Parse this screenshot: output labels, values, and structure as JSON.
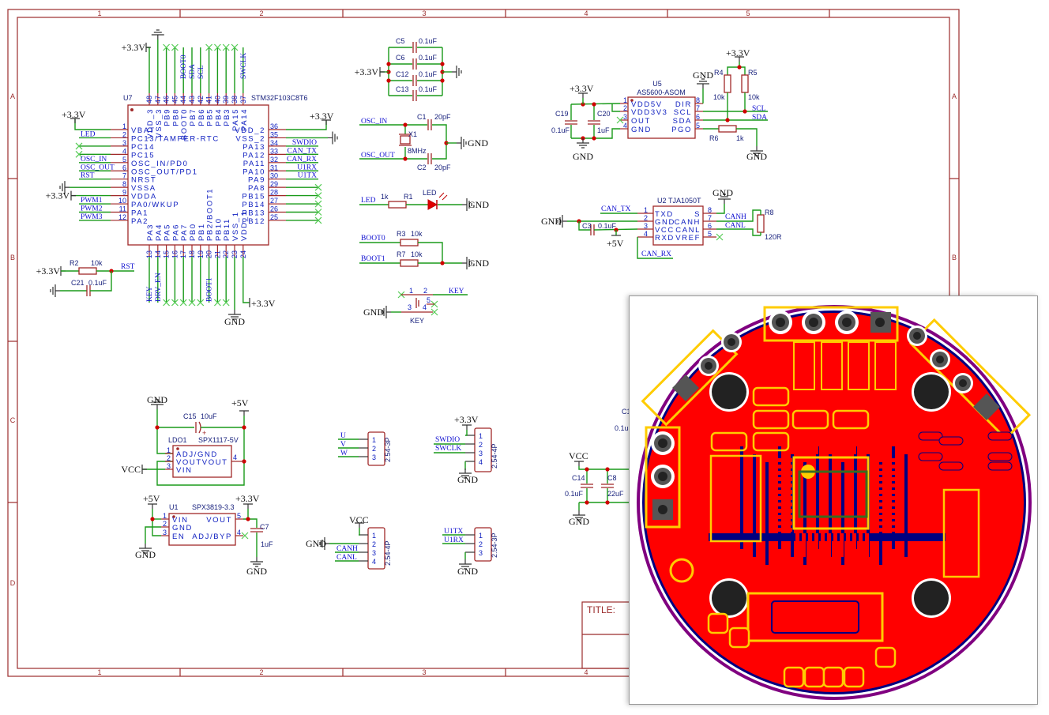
{
  "frame": {
    "cols": [
      "1",
      "2",
      "3",
      "4",
      "5"
    ],
    "rows": [
      "A",
      "B",
      "C",
      "D"
    ]
  },
  "power": {
    "v33": "+3.3V",
    "gnd": "GND",
    "v5": "+5V",
    "vcc": "VCC"
  },
  "mcu": {
    "ref": "U7",
    "part": "STM32F103C8T6",
    "left": [
      {
        "num": "1",
        "name": "VBAT",
        "net": ""
      },
      {
        "num": "2",
        "name": "PC13/TAMPER-RTC",
        "net": "LED"
      },
      {
        "num": "3",
        "name": "PC14",
        "net": "",
        "nc": true
      },
      {
        "num": "4",
        "name": "PC15",
        "net": "",
        "nc": true
      },
      {
        "num": "5",
        "name": "OSC_IN/PD0",
        "net": "OSC_IN"
      },
      {
        "num": "6",
        "name": "OSC_OUT/PD1",
        "net": "OSC_OUT"
      },
      {
        "num": "7",
        "name": "NRST",
        "net": "RST"
      },
      {
        "num": "8",
        "name": "VSSA",
        "net": ""
      },
      {
        "num": "9",
        "name": "VDDA",
        "net": ""
      },
      {
        "num": "10",
        "name": "PA0/WKUP",
        "net": "PWM1"
      },
      {
        "num": "11",
        "name": "PA1",
        "net": "PWM2"
      },
      {
        "num": "12",
        "name": "PA2",
        "net": "PWM3"
      }
    ],
    "right": [
      {
        "num": "36",
        "name": "VDD_2",
        "net": ""
      },
      {
        "num": "35",
        "name": "VSS_2",
        "net": ""
      },
      {
        "num": "34",
        "name": "PA13",
        "net": "SWDIO"
      },
      {
        "num": "33",
        "name": "PA12",
        "net": "CAN_TX"
      },
      {
        "num": "32",
        "name": "PA11",
        "net": "CAN_RX"
      },
      {
        "num": "31",
        "name": "PA10",
        "net": "U1RX"
      },
      {
        "num": "30",
        "name": "PA9",
        "net": "U1TX"
      },
      {
        "num": "29",
        "name": "PA8",
        "net": "",
        "nc": true
      },
      {
        "num": "28",
        "name": "PB15",
        "net": "",
        "nc": true
      },
      {
        "num": "27",
        "name": "PB14",
        "net": "",
        "nc": true
      },
      {
        "num": "26",
        "name": "PB13",
        "net": "",
        "nc": true
      },
      {
        "num": "25",
        "name": "PB12",
        "net": "",
        "nc": true
      }
    ],
    "top": [
      {
        "num": "48",
        "name": "VDD_3",
        "net": ""
      },
      {
        "num": "47",
        "name": "VSS_3",
        "net": ""
      },
      {
        "num": "46",
        "name": "PB9",
        "net": "",
        "nc": true
      },
      {
        "num": "45",
        "name": "PB8",
        "net": "",
        "nc": true
      },
      {
        "num": "44",
        "name": "BOOT0",
        "net": "BOOT0"
      },
      {
        "num": "43",
        "name": "PB7",
        "net": "SDA"
      },
      {
        "num": "42",
        "name": "PB6",
        "net": "SCL"
      },
      {
        "num": "41",
        "name": "PB5",
        "net": "",
        "nc": true
      },
      {
        "num": "40",
        "name": "PB4",
        "net": "",
        "nc": true
      },
      {
        "num": "39",
        "name": "PB3",
        "net": "",
        "nc": true
      },
      {
        "num": "38",
        "name": "PA15",
        "net": "",
        "nc": true
      },
      {
        "num": "37",
        "name": "PA14",
        "net": "SWCLK"
      }
    ],
    "bottom": [
      {
        "num": "13",
        "name": "PA3",
        "net": "KEY"
      },
      {
        "num": "14",
        "name": "PA4",
        "net": "DRV_EN"
      },
      {
        "num": "15",
        "name": "PA5",
        "net": "",
        "nc": true
      },
      {
        "num": "16",
        "name": "PA6",
        "net": "",
        "nc": true
      },
      {
        "num": "17",
        "name": "PA7",
        "net": "",
        "nc": true
      },
      {
        "num": "18",
        "name": "PB0",
        "net": "",
        "nc": true
      },
      {
        "num": "19",
        "name": "PB1",
        "net": "",
        "nc": true
      },
      {
        "num": "20",
        "name": "PB2/BOOT1",
        "net": "BOOT1"
      },
      {
        "num": "21",
        "name": "PB10",
        "net": "",
        "nc": true
      },
      {
        "num": "22",
        "name": "PB11",
        "net": "",
        "nc": true
      },
      {
        "num": "23",
        "name": "VSS_1",
        "net": ""
      },
      {
        "num": "24",
        "name": "VDD_1",
        "net": ""
      }
    ]
  },
  "reset": {
    "r_ref": "R2",
    "r_val": "10k",
    "c_ref": "C21",
    "c_val": "0.1uF",
    "net": "RST"
  },
  "decoupling": {
    "refs": [
      "C5",
      "C6",
      "C12",
      "C13"
    ],
    "value": "0.1uF"
  },
  "osc": {
    "in": "OSC_IN",
    "out": "OSC_OUT",
    "c1": "C1",
    "c1_val": "20pF",
    "c2": "C2",
    "c2_val": "20pF",
    "x1": "X1",
    "x1_val": "8MHz"
  },
  "led": {
    "net": "LED",
    "r_ref": "R1",
    "r_val": "1k",
    "d_ref": "LED"
  },
  "boot": {
    "boot0": "BOOT0",
    "boot1": "BOOT1",
    "r3": "R3",
    "r3_val": "10k",
    "r7": "R7",
    "r7_val": "10k"
  },
  "key": {
    "net": "KEY",
    "ref": "KEY",
    "pins": [
      "1",
      "2",
      "3",
      "4",
      "5"
    ]
  },
  "as5600": {
    "ref": "U5",
    "part": "AS5600-ASOM",
    "left": [
      {
        "num": "1",
        "name": "VDD5V"
      },
      {
        "num": "2",
        "name": "VDD3V3"
      },
      {
        "num": "3",
        "name": "OUT"
      },
      {
        "num": "4",
        "name": "GND"
      }
    ],
    "right": [
      {
        "num": "8",
        "name": "DIR"
      },
      {
        "num": "7",
        "name": "SCL"
      },
      {
        "num": "6",
        "name": "SDA"
      },
      {
        "num": "5",
        "name": "PGO"
      }
    ],
    "c19": "C19",
    "c19_val": "0.1uF",
    "c20": "C20",
    "c20_val": "1uF",
    "r4": "R4",
    "r4_val": "10k",
    "r5": "R5",
    "r5_val": "10k",
    "r6": "R6",
    "r6_val": "1k",
    "scl": "SCL",
    "sda": "SDA"
  },
  "can": {
    "ref": "U2",
    "part": "TJA1050T",
    "left": [
      {
        "num": "1",
        "name": "TXD"
      },
      {
        "num": "2",
        "name": "GND"
      },
      {
        "num": "3",
        "name": "VCC"
      },
      {
        "num": "4",
        "name": "RXD"
      }
    ],
    "right": [
      {
        "num": "8",
        "name": "S"
      },
      {
        "num": "7",
        "name": "CANH"
      },
      {
        "num": "6",
        "name": "CANL"
      },
      {
        "num": "5",
        "name": "VREF"
      }
    ],
    "c3": "C3",
    "c3_val": "0.1uF",
    "r8": "R8",
    "r8_val": "120R",
    "can_tx": "CAN_TX",
    "can_rx": "CAN_RX",
    "canh": "CANH",
    "canl": "CANL"
  },
  "ldo": {
    "ref": "LDO1",
    "part": "SPX1117-5V",
    "c15": "C15",
    "c15_val": "10uF",
    "left": [
      {
        "num": "1",
        "name": "ADJ/GND"
      },
      {
        "num": "2",
        "name": "VOUTVOUT"
      },
      {
        "num": "3",
        "name": "VIN"
      }
    ],
    "right_num": "4"
  },
  "u1": {
    "ref": "U1",
    "part": "SPX3819-3.3",
    "c7": "C7",
    "c7_val": "1uF",
    "left": [
      {
        "num": "1",
        "name": "VIN"
      },
      {
        "num": "2",
        "name": "GND"
      },
      {
        "num": "3",
        "name": "EN"
      }
    ],
    "right": [
      {
        "num": "5",
        "name": "VOUT"
      },
      {
        "num": "4",
        "name": "ADJ/BYP"
      }
    ]
  },
  "connectors": [
    {
      "part": "2.54-3P",
      "pins": [
        "1",
        "2",
        "3"
      ],
      "nets": [
        "U",
        "V",
        "W"
      ]
    },
    {
      "part": "2.54-4P",
      "pins": [
        "1",
        "2",
        "3",
        "4"
      ],
      "nets": [
        "",
        "SWDIO",
        "SWCLK",
        ""
      ]
    },
    {
      "part": "2.54-4P",
      "pins": [
        "1",
        "2",
        "3",
        "4"
      ],
      "nets": [
        "",
        "",
        "CANH",
        "CANL"
      ]
    },
    {
      "part": "2.54-3P",
      "pins": [
        "1",
        "2",
        "3"
      ],
      "nets": [
        "U1TX",
        "U1RX",
        ""
      ]
    }
  ],
  "bulk": {
    "c14": "C14",
    "c14_val": "0.1uF",
    "c8": "C8",
    "c8_val": "22uF",
    "hidden_ref": "C1",
    "hidden_val": "0.1u"
  },
  "title_block": {
    "title": "TITLE:"
  },
  "pcb_preview": {
    "board_color": "#ff0000",
    "bottom_copper": "#000080",
    "silkscreen": "#ffcc00",
    "outline": "#800080"
  }
}
